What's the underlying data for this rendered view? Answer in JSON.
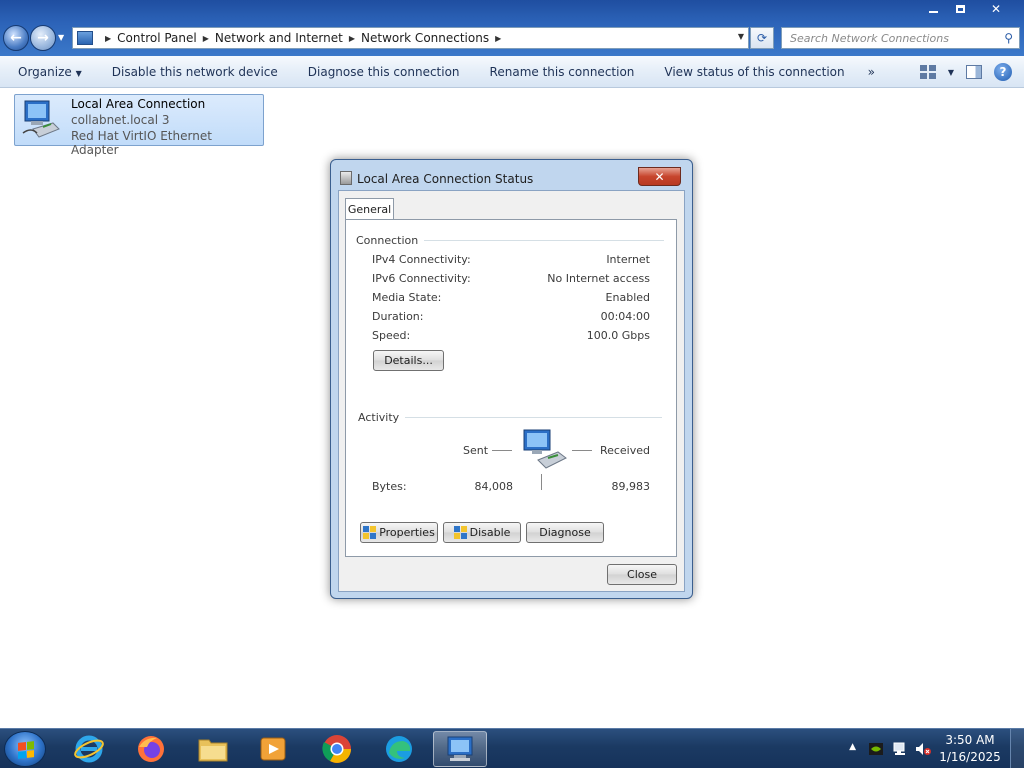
{
  "window": {
    "controls": {
      "minimize": "minimize",
      "restore": "restore",
      "close": "close"
    }
  },
  "address_bar": {
    "crumbs": [
      "Control Panel",
      "Network and Internet",
      "Network Connections"
    ]
  },
  "search": {
    "placeholder": "Search Network Connections"
  },
  "command_bar": {
    "organize": "Organize",
    "disable": "Disable this network device",
    "diagnose": "Diagnose this connection",
    "rename": "Rename this connection",
    "view_status": "View status of this connection",
    "more": "»"
  },
  "connection_item": {
    "name": "Local Area Connection",
    "network": "collabnet.local  3",
    "adapter": "Red Hat VirtIO Ethernet Adapter"
  },
  "dialog": {
    "title": "Local Area Connection Status",
    "tab": "General",
    "connection_group": "Connection",
    "rows": [
      {
        "label": "IPv4 Connectivity:",
        "value": "Internet"
      },
      {
        "label": "IPv6 Connectivity:",
        "value": "No Internet access"
      },
      {
        "label": "Media State:",
        "value": "Enabled"
      },
      {
        "label": "Duration:",
        "value": "00:04:00"
      },
      {
        "label": "Speed:",
        "value": "100.0 Gbps"
      }
    ],
    "details_button": "Details...",
    "activity_group": "Activity",
    "sent_label": "Sent",
    "received_label": "Received",
    "bytes_label": "Bytes:",
    "bytes_sent": "84,008",
    "bytes_received": "89,983",
    "properties_button": "Properties",
    "disable_button": "Disable",
    "diagnose_button": "Diagnose",
    "close_button": "Close"
  },
  "taskbar": {
    "apps": [
      "internet-explorer",
      "firefox",
      "file-explorer",
      "media-player",
      "chrome",
      "edge",
      "network-connections"
    ],
    "clock_time": "3:50 AM",
    "clock_date": "1/16/2025"
  }
}
